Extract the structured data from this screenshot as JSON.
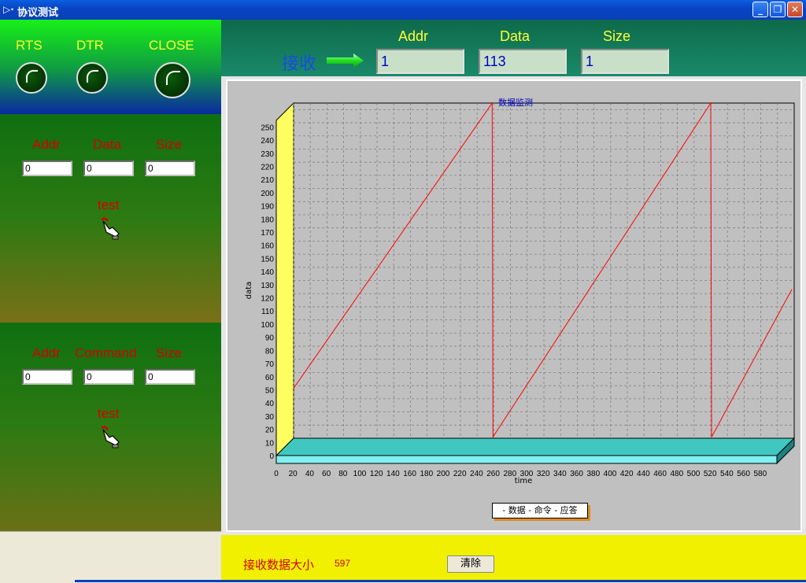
{
  "window": {
    "icon": "▷·",
    "title": "协议测试",
    "minimize_icon": "minimize-icon",
    "maximize_icon": "restore-icon",
    "close_icon": "close-icon"
  },
  "status_panel": {
    "rts_label": "RTS",
    "dtr_label": "DTR",
    "close_label": "CLOSE"
  },
  "send_data": {
    "addr_label": "Addr",
    "data_label": "Data",
    "size_label": "Size",
    "addr_value": "0",
    "data_value": "0",
    "size_value": "0",
    "test_label": "test"
  },
  "send_command": {
    "addr_label": "Addr",
    "command_label": "Command",
    "size_label": "Size",
    "addr_value": "0",
    "command_value": "0",
    "size_value": "0",
    "test_label": "test"
  },
  "receive": {
    "label": "接收",
    "addr_label": "Addr",
    "data_label": "Data",
    "size_label": "Size",
    "addr_value": "1",
    "data_value": "113",
    "size_value": "1"
  },
  "legend": {
    "text": "- 数据 - 命令 - 应答"
  },
  "footer": {
    "received_size_label": "接收数据大小",
    "received_size_value": "597",
    "clear_button": "清除"
  },
  "colors": {
    "series_line": "#ff0000",
    "floor": "#40c8c0",
    "wall": "#ffff60"
  },
  "chart_data": {
    "type": "line",
    "title": "数据监测",
    "xlabel": "time",
    "ylabel": "data",
    "xlim": [
      0,
      600
    ],
    "ylim": [
      0,
      255
    ],
    "xticks": [
      0,
      20,
      40,
      60,
      80,
      100,
      120,
      140,
      160,
      180,
      200,
      220,
      240,
      260,
      280,
      300,
      320,
      340,
      360,
      380,
      400,
      420,
      440,
      460,
      480,
      500,
      520,
      540,
      560,
      580
    ],
    "yticks": [
      0,
      10,
      20,
      30,
      40,
      50,
      60,
      70,
      80,
      90,
      100,
      110,
      120,
      130,
      140,
      150,
      160,
      170,
      180,
      190,
      200,
      210,
      220,
      230,
      240,
      250
    ],
    "grid": true,
    "legend_position": "bottom-center",
    "series": [
      {
        "x": [
          0,
          238,
          239,
          500,
          501,
          597
        ],
        "values": [
          38,
          255,
          1,
          255,
          1,
          113
        ]
      }
    ]
  }
}
